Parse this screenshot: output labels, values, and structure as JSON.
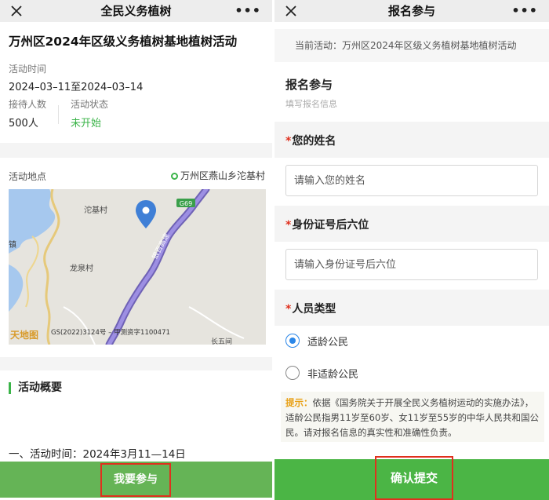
{
  "left": {
    "nav_title": "全民义务植树",
    "nav_more": "•••",
    "activity_title": "万州区2024年区级义务植树基地植树活动",
    "time_label": "活动时间",
    "time_value": "2024–03–11至2024–03–14",
    "capacity_label": "接待人数",
    "capacity_value": "500人",
    "status_label": "活动状态",
    "status_value": "未开始",
    "location_label": "活动地点",
    "location_value": "万州区燕山乡沱基村",
    "map": {
      "village_1": "沱基村",
      "village_2": "龙泉村",
      "road_badge": "G69",
      "road_name": "银百高速",
      "edge_text": "镇",
      "copyright": "GS(2022)3124号 – 甲测资字1100471",
      "place_3": "长五间",
      "logo_text": "天地图"
    },
    "overview_heading": "活动概要",
    "overview_line": "一、活动时间：2024年3月11—14日",
    "join_button": "我要参与"
  },
  "right": {
    "nav_title": "报名参与",
    "nav_more": "•••",
    "banner_text": "当前活动：万州区2024年区级义务植树基地植树活动",
    "heading": "报名参与",
    "subheading": "填写报名信息",
    "required_mark": "*",
    "name_label": "您的姓名",
    "name_placeholder": "请输入您的姓名",
    "id_label": "身份证号后六位",
    "id_placeholder": "请输入身份证号后六位",
    "type_label": "人员类型",
    "option_1": "适龄公民",
    "option_2": "非适龄公民",
    "selected_option": "适龄公民",
    "notice_tip": "提示：",
    "notice_text": "依据《国务院关于开展全民义务植树运动的实施办法》，适龄公民指男11岁至60岁、女11岁至55岁的中华人民共和国公民。请对报名信息的真实性和准确性负责。",
    "submit_button": "确认提交"
  },
  "colors": {
    "accent_green": "#3bb449",
    "button_green": "#4bb545",
    "highlight_red": "#e0301e",
    "radio_blue": "#2a86e8",
    "tip_orange": "#e8a015"
  }
}
